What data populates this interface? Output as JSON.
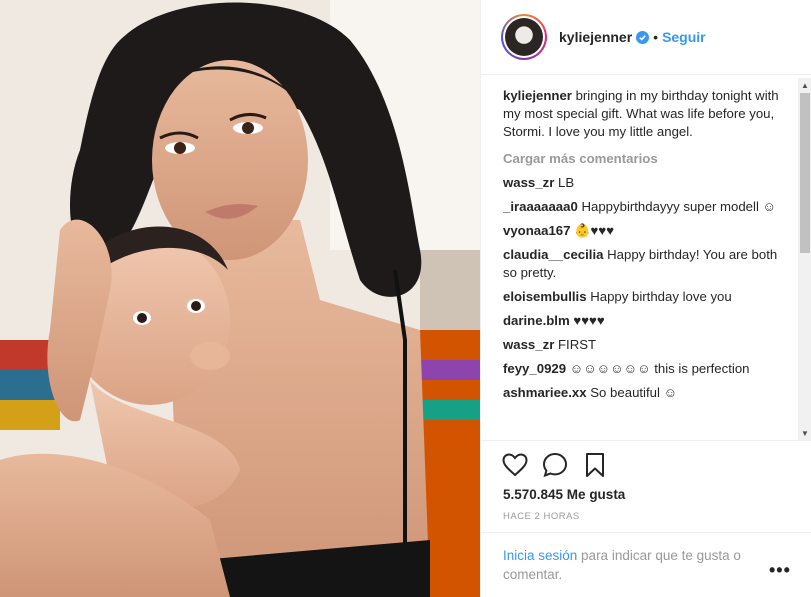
{
  "header": {
    "username": "kyliejenner",
    "separator": "•",
    "follow_label": "Seguir"
  },
  "caption": {
    "username": "kyliejenner",
    "text": "bringing in my birthday tonight with my most special gift. What was life before you, Stormi. I love you my little angel."
  },
  "load_more_label": "Cargar más comentarios",
  "comments": [
    {
      "user": "wass_zr",
      "text": "LB"
    },
    {
      "user": "_iraaaaaaa0",
      "text": "Happybirthdayyy super modell ☺"
    },
    {
      "user": "vyonaa167",
      "text": "👶♥♥♥"
    },
    {
      "user": "claudia__cecilia",
      "text": "Happy birthday! You are both so pretty."
    },
    {
      "user": "eloisembullis",
      "text": "Happy birthday love you"
    },
    {
      "user": "darine.blm",
      "text": "♥♥♥♥"
    },
    {
      "user": "wass_zr",
      "text": "FIRST"
    },
    {
      "user": "feyy_0929",
      "text": "☺☺☺☺☺☺ this is perfection"
    },
    {
      "user": "ashmariee.xx",
      "text": "So beautiful ☺"
    }
  ],
  "likes": "5.570.845 Me gusta",
  "timestamp": "HACE 2 HORAS",
  "login": {
    "link_label": "Inicia sesión",
    "text": " para indicar que te gusta o comentar."
  },
  "more_label": "•••",
  "icons": {
    "verified": "verified-badge-icon",
    "like": "heart-icon",
    "comment": "comment-bubble-icon",
    "save": "bookmark-icon",
    "more": "more-options-icon"
  },
  "colors": {
    "accent": "#3897f0",
    "muted": "#999999",
    "text": "#262626"
  }
}
